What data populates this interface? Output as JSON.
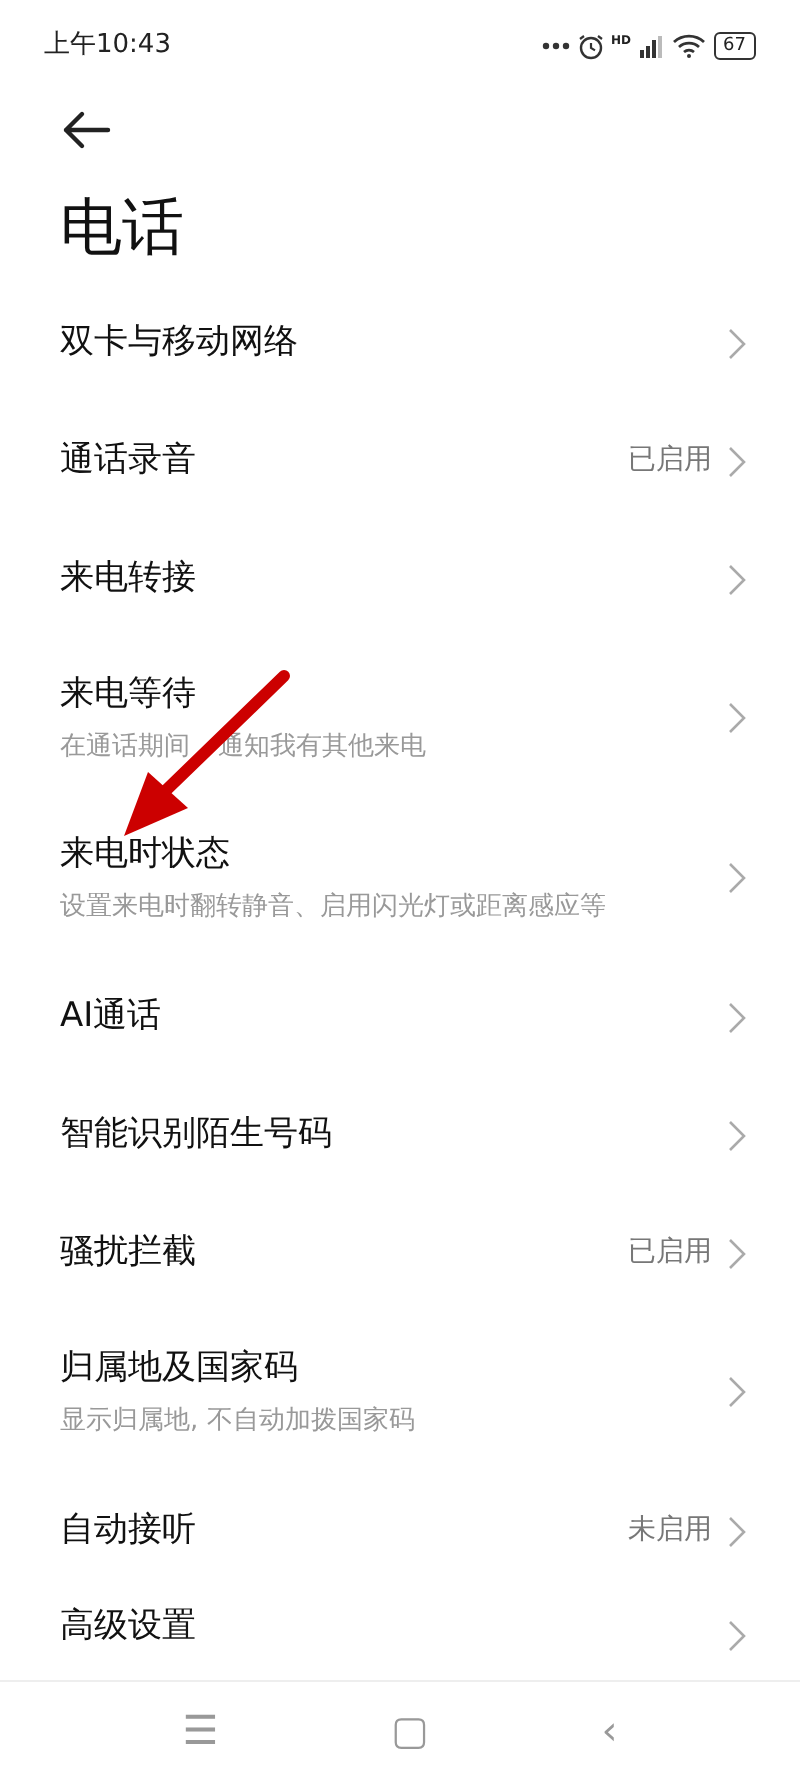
{
  "status_bar": {
    "time": "上午10:43",
    "signal_label": "HD",
    "battery": "67"
  },
  "title": "电话",
  "items": [
    {
      "title": "双卡与移动网络"
    },
    {
      "title": "通话录音",
      "value": "已启用"
    },
    {
      "title": "来电转接"
    },
    {
      "title": "来电等待",
      "subtitle": [
        "在通话期间",
        "通知我有其他来电"
      ]
    },
    {
      "title": "来电时状态",
      "subtitle": "设置来电时翻转静音、启用闪光灯或距离感应等"
    },
    {
      "title": "AI通话"
    },
    {
      "title": "智能识别陌生号码"
    },
    {
      "title": "骚扰拦截",
      "value": "已启用"
    },
    {
      "title": "归属地及国家码",
      "subtitle": "显示归属地, 不自动加拨国家码"
    },
    {
      "title": "自动接听",
      "value": "未启用"
    },
    {
      "title": "高级设置"
    }
  ],
  "nav_bar": [
    "☰",
    "▢",
    "‹"
  ]
}
